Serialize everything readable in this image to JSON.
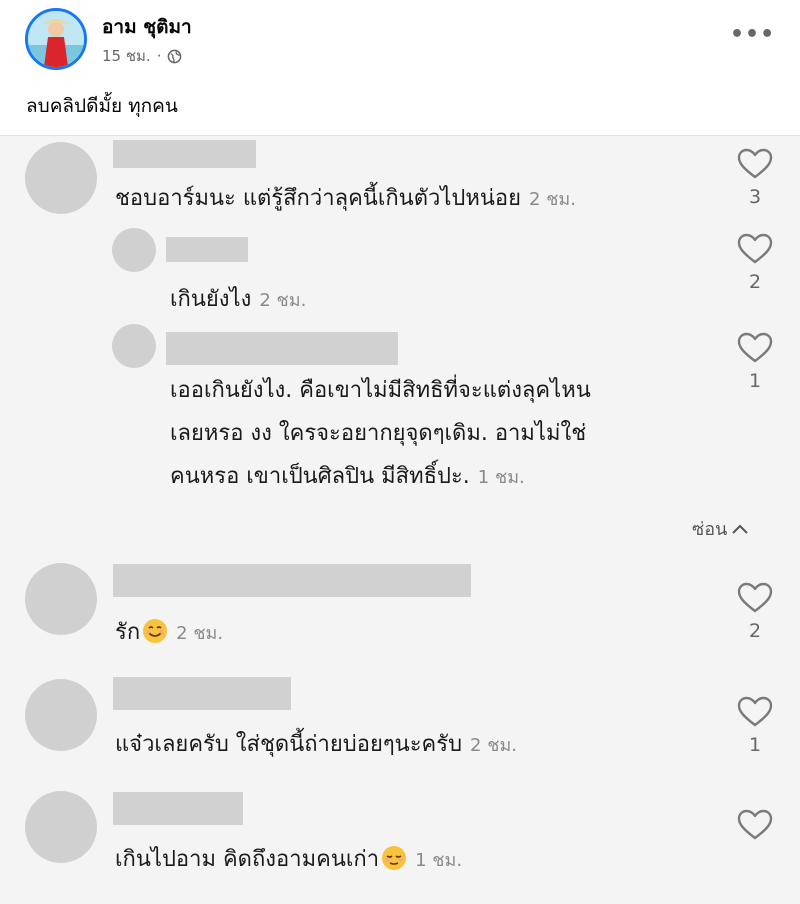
{
  "post": {
    "author": "อาม ชุติมา",
    "time": "15 ชม.",
    "caption": "ลบคลิปดีมั้ย ทุกคน",
    "more_label": "•••"
  },
  "comments": [
    {
      "text": "ชอบอาร์มนะ แต่รู้สึกว่าลุคนี้เกินตัวไปหน่อย",
      "time": "2 ชม.",
      "likes": "3"
    },
    {
      "text": "เกินยังไง",
      "time": "2 ชม.",
      "likes": "2"
    },
    {
      "lines": [
        "เออเกินยังไง. คือเขาไม่มีสิทธิที่จะแต่งลุคไหน",
        "เลยหรอ งง ใครจะอยากยุจุดๆเดิม. อามไม่ใช่",
        "คนหรอ เขาเป็นศิลปิน มีสิทธิ์ปะ."
      ],
      "time": "1 ชม.",
      "likes": "1"
    },
    {
      "text": "รัก",
      "time": "2 ชม.",
      "likes": "2"
    },
    {
      "text": "แจ๋วเลยครับ ใส่ชุดนี้ถ่ายบ่อยๆนะครับ",
      "time": "2 ชม.",
      "likes": "1"
    },
    {
      "text": "เกินไปอาม คิดถึงอามคนเก่า",
      "time": "1 ชม.",
      "likes": ""
    }
  ],
  "hide_replies_label": "ซ่อน",
  "colors": {
    "accent": "#1877f2",
    "blur": "#d1d1d1",
    "shot_bg": "#f4f4f4"
  },
  "icons": [
    "globe-icon",
    "heart-icon",
    "chevron-up-icon",
    "smile-emoji-icon",
    "relieved-emoji-icon"
  ]
}
